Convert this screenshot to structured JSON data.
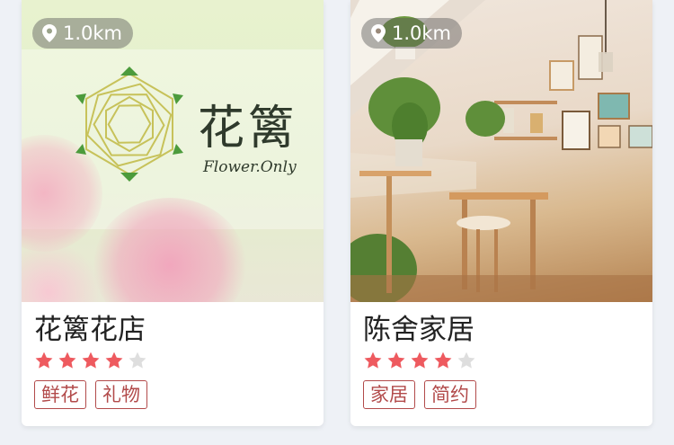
{
  "cards": [
    {
      "distance": "1.0km",
      "image": "flower-shop-logo-image",
      "logo_text": "花篱",
      "logo_subtext": "Flower.Only",
      "name": "花篱花店",
      "rating": 4,
      "rating_max": 5,
      "tags": [
        "鲜花",
        "礼物"
      ]
    },
    {
      "distance": "1.0km",
      "image": "furniture-room-image",
      "name": "陈舍家居",
      "rating": 4,
      "rating_max": 5,
      "tags": [
        "家居",
        "简约"
      ]
    }
  ],
  "colors": {
    "star_filled": "#ee5a5f",
    "star_empty": "#dedede",
    "tag_border": "#b24a4a",
    "background": "#eef1f6"
  }
}
